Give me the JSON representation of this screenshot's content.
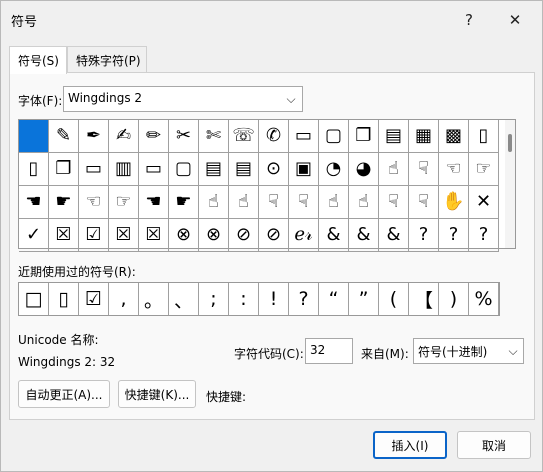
{
  "window": {
    "title": "符号",
    "help": "?",
    "close": "✕"
  },
  "tabs": [
    {
      "label": "符号(S)"
    },
    {
      "label": "特殊字符(P)"
    }
  ],
  "font": {
    "label": "字体(F):",
    "value": "Wingdings 2",
    "arrow": "⌵"
  },
  "symbol_grid": {
    "rows": [
      [
        "",
        "✎",
        "✒",
        "✍",
        "✏",
        "✂",
        "✄",
        "☏",
        "✆",
        "▭",
        "▢",
        "❐",
        "▤",
        "▦",
        "▩",
        "▯"
      ],
      [
        "▯",
        "❐",
        "▭",
        "▥",
        "▭",
        "▢",
        "▤",
        "▤",
        "⊙",
        "▣",
        "◔",
        "◕",
        "☝",
        "☟",
        "☜",
        "☞"
      ],
      [
        "☚",
        "☛",
        "☜",
        "☞",
        "☚",
        "☛",
        "☝",
        "☝",
        "☟",
        "☟",
        "☝",
        "☝",
        "☟",
        "☟",
        "✋",
        "✕"
      ],
      [
        "✓",
        "☒",
        "☑",
        "☒",
        "☒",
        "⊗",
        "⊗",
        "⊘",
        "⊘",
        "ℯ𝓇",
        "&",
        "&",
        "&",
        "?",
        "?",
        "?"
      ]
    ],
    "selected_index": 0
  },
  "recent": {
    "label": "近期使用过的符号(R):",
    "items": [
      "□",
      "▯",
      "☑",
      ",",
      "。",
      "、",
      ";",
      ":",
      "!",
      "?",
      "“",
      "”",
      "(",
      "【",
      ")",
      "%"
    ]
  },
  "unicode": {
    "label": "Unicode 名称:",
    "value": "Wingdings 2: 32"
  },
  "char_code": {
    "label": "字符代码(C):",
    "value": "32"
  },
  "from": {
    "label": "来自(M):",
    "value": "符号(十进制)",
    "arrow": "⌵"
  },
  "buttons": {
    "autocorrect": "自动更正(A)...",
    "shortcut_key": "快捷键(K)...",
    "shortcut_label": "快捷键:",
    "insert": "插入(I)",
    "cancel": "取消"
  },
  "colors": {
    "selection": "#0a74da",
    "accent": "#0a64c8"
  }
}
